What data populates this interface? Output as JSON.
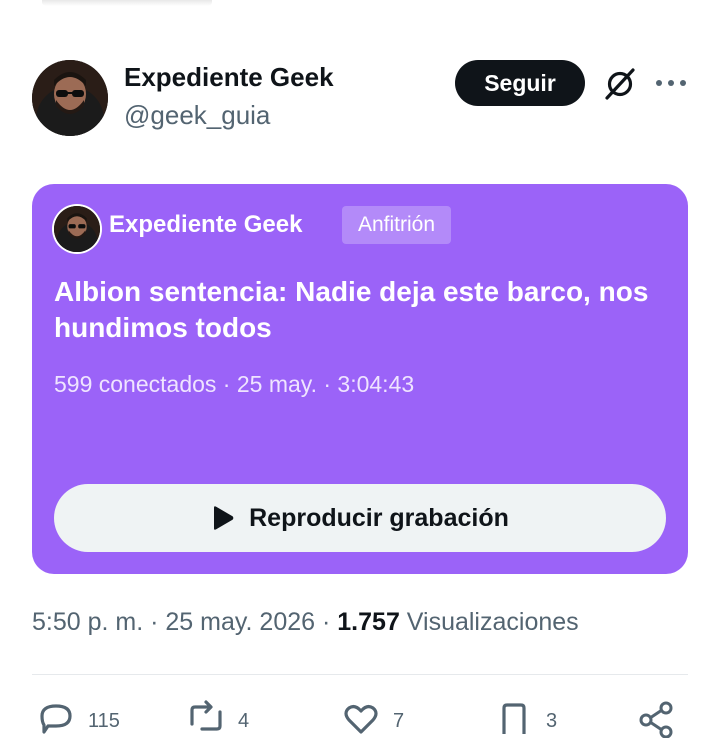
{
  "author": {
    "display_name": "Expediente Geek",
    "handle": "@geek_guia",
    "avatar_icon": "profile-photo"
  },
  "header_actions": {
    "follow_label": "Seguir",
    "grok_icon": "grok-icon",
    "more_icon": "more-icon"
  },
  "space": {
    "host_name": "Expediente Geek",
    "host_badge": "Anfitrión",
    "title": "Albion sentencia: Nadie deja este barco, nos hundimos todos",
    "listeners": "599 conectados",
    "date": "25 may.",
    "duration": "3:04:43",
    "separator": "·",
    "play_label": "Reproducir grabación",
    "accent_color": "#9b63f8"
  },
  "meta": {
    "time": "5:50 p. m.",
    "date": "25 may. 2026",
    "separator": "·",
    "views_count": "1.757",
    "views_label": "Visualizaciones"
  },
  "actions": {
    "replies": "115",
    "reposts": "4",
    "likes": "7",
    "bookmarks": "3"
  }
}
